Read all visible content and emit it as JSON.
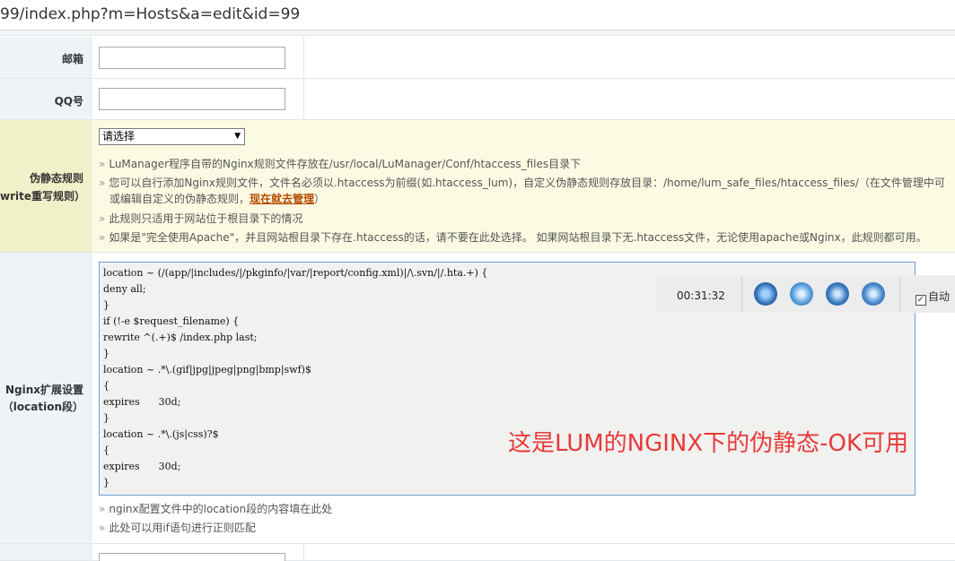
{
  "browser": {
    "url": "99/index.php?m=Hosts&a=edit&id=99"
  },
  "form": {
    "email": {
      "label": "邮箱",
      "value": ""
    },
    "qq": {
      "label": "QQ号",
      "value": ""
    },
    "rewrite": {
      "label_line1": "伪静态规则",
      "label_line2": "rewrite重写规则）",
      "select_value": "请选择",
      "hints": [
        "LuManager程序自带的Nginx规则文件存放在/usr/local/LuManager/Conf/htaccess_files目录下",
        "您可以自行添加Nginx规则文件，文件名必须以.htaccess为前缀(如.htaccess_lum)，自定义伪静态规则存放目录：/home/lum_safe_files/htaccess_files/（在文件管理中可",
        "或编辑自定义的伪静态规则，",
        "）",
        "此规则只适用于网站位于根目录下的情况",
        "如果是\"完全使用Apache\"，并且网站根目录下存在.htaccess的话，请不要在此处选择。 如果网站根目录下无.htaccess文件，无论使用apache或Nginx，此规则都可用。"
      ],
      "manage_link": "现在就去管理"
    },
    "nginx": {
      "label_line1": "Nginx扩展设置",
      "label_line2": "（location段）",
      "code_lines": [
        "location ~ (/(app/|includes/|/pkginfo/|var/|report/config.xml)|/\\.svn/|/.hta.+) {",
        "deny all;",
        "}",
        "if (!-e $request_filename) {",
        "rewrite ^(.+)$ /index.php last;",
        "}",
        "location ~ .*\\.(gif|jpg|jpeg|png|bmp|swf)$",
        "{",
        "expires      30d;",
        "}",
        "location ~ .*\\.(js|css)?$",
        "{",
        "expires      30d;",
        "}"
      ],
      "hints": [
        "nginx配置文件中的location段的内容填在此处",
        "此处可以用if语句进行正则匹配"
      ],
      "overlay_text": "这是LUM的NGINX下的伪静态-OK可用"
    }
  },
  "player": {
    "time": "00:31:32",
    "auto_label": "自动",
    "auto_checked": "✓",
    "icons": [
      "gear-icon",
      "music-icon",
      "power-icon",
      "refresh-icon"
    ]
  }
}
